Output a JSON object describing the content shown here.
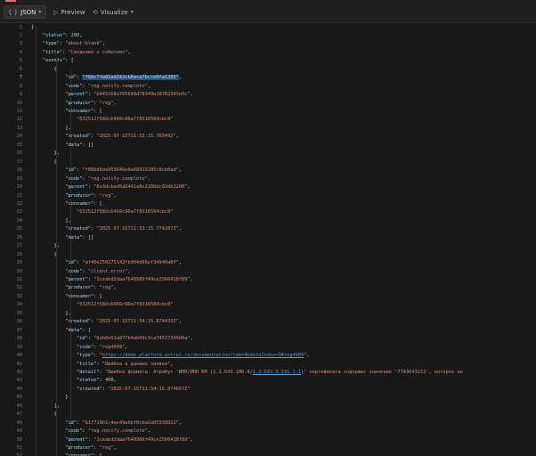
{
  "toolbar": {
    "json_label": "JSON",
    "preview_label": "Preview",
    "visualize_label": "Visualize"
  },
  "lines": [
    [
      [
        "p",
        "{"
      ]
    ],
    [
      [
        "p",
        "    "
      ],
      [
        "k",
        "\"status\""
      ],
      [
        "p",
        ": "
      ],
      [
        "n",
        "200"
      ],
      [
        "p",
        ","
      ]
    ],
    [
      [
        "p",
        "    "
      ],
      [
        "k",
        "\"type\""
      ],
      [
        "p",
        ": "
      ],
      [
        "s",
        "\"about:blank\""
      ],
      [
        "p",
        ","
      ]
    ],
    [
      [
        "p",
        "    "
      ],
      [
        "k",
        "\"title\""
      ],
      [
        "p",
        ": "
      ],
      [
        "s",
        "\"Сведения о событиях\""
      ],
      [
        "p",
        ","
      ]
    ],
    [
      [
        "p",
        "    "
      ],
      [
        "k",
        "\"events\""
      ],
      [
        "p",
        ": ["
      ]
    ],
    [
      [
        "p",
        "        {"
      ]
    ],
    [
      [
        "p",
        "            "
      ],
      [
        "k",
        "\"id\""
      ],
      [
        "p",
        ": "
      ],
      [
        "sel",
        "\"f68c7fa81ad242cb8aca7bcce0fa1285\""
      ],
      [
        "p",
        ","
      ]
    ],
    [
      [
        "p",
        "            "
      ],
      [
        "k",
        "\"code\""
      ],
      [
        "p",
        ": "
      ],
      [
        "s",
        "\"reg.notify.complete\""
      ],
      [
        "p",
        ","
      ]
    ],
    [
      [
        "p",
        "            "
      ],
      [
        "k",
        "\"parent\""
      ],
      [
        "p",
        ": "
      ],
      [
        "s",
        "\"b445168a765648d78349a18702343e6c\""
      ],
      [
        "p",
        ","
      ]
    ],
    [
      [
        "p",
        "            "
      ],
      [
        "k",
        "\"producer\""
      ],
      [
        "p",
        ": "
      ],
      [
        "s",
        "\"reg\""
      ],
      [
        "p",
        ","
      ]
    ],
    [
      [
        "p",
        "            "
      ],
      [
        "k",
        "\"consumer\""
      ],
      [
        "p",
        ": ["
      ]
    ],
    [
      [
        "p",
        "                "
      ],
      [
        "s",
        "\"632512f58dc6466c96a7f8316584cbc8\""
      ]
    ],
    [
      [
        "p",
        "            ],"
      ]
    ],
    [
      [
        "p",
        "            "
      ],
      [
        "k",
        "\"created\""
      ],
      [
        "p",
        ": "
      ],
      [
        "s",
        "\"2025-07-15T11:53:15.765492\""
      ],
      [
        "p",
        ","
      ]
    ],
    [
      [
        "p",
        "            "
      ],
      [
        "k",
        "\"data\""
      ],
      [
        "p",
        ": []"
      ]
    ],
    [
      [
        "p",
        "        },"
      ]
    ],
    [
      [
        "p",
        "        {"
      ]
    ],
    [
      [
        "p",
        "            "
      ],
      [
        "k",
        "\"id\""
      ],
      [
        "p",
        ": "
      ],
      [
        "s",
        "\"f08bd6da953646e6a68915285c8cb0ad\""
      ],
      [
        "p",
        ","
      ]
    ],
    [
      [
        "p",
        "            "
      ],
      [
        "k",
        "\"code\""
      ],
      [
        "p",
        ": "
      ],
      [
        "s",
        "\"reg.notify.complete\""
      ],
      [
        "p",
        ","
      ]
    ],
    [
      [
        "p",
        "            "
      ],
      [
        "k",
        "\"parent\""
      ],
      [
        "p",
        ": "
      ],
      [
        "s",
        "\"6e3dcbad5d2491a8e2206dc93db2200\""
      ],
      [
        "p",
        ","
      ]
    ],
    [
      [
        "p",
        "            "
      ],
      [
        "k",
        "\"producer\""
      ],
      [
        "p",
        ": "
      ],
      [
        "s",
        "\"reg\""
      ],
      [
        "p",
        ","
      ]
    ],
    [
      [
        "p",
        "            "
      ],
      [
        "k",
        "\"consumer\""
      ],
      [
        "p",
        ": ["
      ]
    ],
    [
      [
        "p",
        "                "
      ],
      [
        "s",
        "\"632512f58dc6466c96a7f8316584cbc8\""
      ]
    ],
    [
      [
        "p",
        "            ],"
      ]
    ],
    [
      [
        "p",
        "            "
      ],
      [
        "k",
        "\"created\""
      ],
      [
        "p",
        ": "
      ],
      [
        "s",
        "\"2025-07-15T11:53:15.774287Z\""
      ],
      [
        "p",
        ","
      ]
    ],
    [
      [
        "p",
        "            "
      ],
      [
        "k",
        "\"data\""
      ],
      [
        "p",
        ": []"
      ]
    ],
    [
      [
        "p",
        "        },"
      ]
    ],
    [
      [
        "p",
        "        {"
      ]
    ],
    [
      [
        "p",
        "            "
      ],
      [
        "k",
        "\"id\""
      ],
      [
        "p",
        ": "
      ],
      [
        "s",
        "\"af40e250275142fb904d66ef34940a0f\""
      ],
      [
        "p",
        ","
      ]
    ],
    [
      [
        "p",
        "            "
      ],
      [
        "k",
        "\"code\""
      ],
      [
        "p",
        ": "
      ],
      [
        "s",
        "\"client.error\""
      ],
      [
        "p",
        ","
      ]
    ],
    [
      [
        "p",
        "            "
      ],
      [
        "k",
        "\"parent\""
      ],
      [
        "p",
        ": "
      ],
      [
        "s",
        "\"1ceabd2daa7640989f49ce2566418f89\""
      ],
      [
        "p",
        ","
      ]
    ],
    [
      [
        "p",
        "            "
      ],
      [
        "k",
        "\"producer\""
      ],
      [
        "p",
        ": "
      ],
      [
        "s",
        "\"reg\""
      ],
      [
        "p",
        ","
      ]
    ],
    [
      [
        "p",
        "            "
      ],
      [
        "k",
        "\"consumer\""
      ],
      [
        "p",
        ": ["
      ]
    ],
    [
      [
        "p",
        "                "
      ],
      [
        "s",
        "\"632512f58dc6466c96a7f8316584cbc8\""
      ]
    ],
    [
      [
        "p",
        "            ],"
      ]
    ],
    [
      [
        "p",
        "            "
      ],
      [
        "k",
        "\"created\""
      ],
      [
        "p",
        ": "
      ],
      [
        "s",
        "\"2025-07-15T11:54:15.874433Z\""
      ],
      [
        "p",
        ","
      ]
    ],
    [
      [
        "p",
        "            "
      ],
      [
        "k",
        "\"data\""
      ],
      [
        "p",
        ": ["
      ]
    ],
    [
      [
        "p",
        "                "
      ],
      [
        "k",
        "\"id\""
      ],
      [
        "p",
        ": "
      ],
      [
        "s",
        "\"6eb6e61a977b4ab09c3ca74537349d0a\""
      ],
      [
        "p",
        ","
      ]
    ],
    [
      [
        "p",
        "                "
      ],
      [
        "k",
        "\"code\""
      ],
      [
        "p",
        ": "
      ],
      [
        "s",
        "\"reg4009\""
      ],
      [
        "p",
        ","
      ]
    ],
    [
      [
        "p",
        "                "
      ],
      [
        "k",
        "\"type\""
      ],
      [
        "p",
        ": "
      ],
      [
        "s",
        "\""
      ],
      [
        "u",
        "https://demo.platform.astral.ru/documentation?tab=4&dataIndex=3#reg4009"
      ],
      [
        "s",
        "\""
      ],
      [
        "p",
        ","
      ]
    ],
    [
      [
        "p",
        "                "
      ],
      [
        "k",
        "\"title\""
      ],
      [
        "p",
        ": "
      ],
      [
        "s",
        "\"Ошибка в данных заявки\""
      ],
      [
        "p",
        ","
      ]
    ],
    [
      [
        "p",
        "                "
      ],
      [
        "k",
        "\"detail\""
      ],
      [
        "p",
        ": "
      ],
      [
        "s",
        "\"Ошибка формата. Атрибут 'ИНН/ИНН ЮЛ (1.2.643.100.4/"
      ],
      [
        "u",
        "1.2.643.3.131.1.1"
      ],
      [
        "s",
        ")' сертификата содержит значение '7743643222', которое не"
      ]
    ],
    [
      [
        "p",
        "                "
      ],
      [
        "k",
        "\"status\""
      ],
      [
        "p",
        ": "
      ],
      [
        "n",
        "400"
      ],
      [
        "p",
        ","
      ]
    ],
    [
      [
        "p",
        "                "
      ],
      [
        "k",
        "\"created\""
      ],
      [
        "p",
        ": "
      ],
      [
        "s",
        "\"2025-07-15T11:54:15.874667Z\""
      ]
    ],
    [
      [
        "p",
        "            }"
      ]
    ],
    [
      [
        "p",
        "        ],"
      ]
    ],
    [
      [
        "p",
        "        {"
      ]
    ],
    [
      [
        "p",
        "            "
      ],
      [
        "k",
        "\"id\""
      ],
      [
        "p",
        ": "
      ],
      [
        "s",
        "\"b1f716b1c4ae49abbf0cba2a05939012\""
      ],
      [
        "p",
        ","
      ]
    ],
    [
      [
        "p",
        "            "
      ],
      [
        "k",
        "\"code\""
      ],
      [
        "p",
        ": "
      ],
      [
        "s",
        "\"reg.notify.complete\""
      ],
      [
        "p",
        ","
      ]
    ],
    [
      [
        "p",
        "            "
      ],
      [
        "k",
        "\"parent\""
      ],
      [
        "p",
        ": "
      ],
      [
        "s",
        "\"1ceabd2daa7640989f49ce2566418f89\""
      ],
      [
        "p",
        ","
      ]
    ],
    [
      [
        "p",
        "            "
      ],
      [
        "k",
        "\"producer\""
      ],
      [
        "p",
        ": "
      ],
      [
        "s",
        "\"reg\""
      ],
      [
        "p",
        ","
      ]
    ],
    [
      [
        "p",
        "            "
      ],
      [
        "k",
        "\"consumer\""
      ],
      [
        "p",
        ": ["
      ]
    ]
  ]
}
